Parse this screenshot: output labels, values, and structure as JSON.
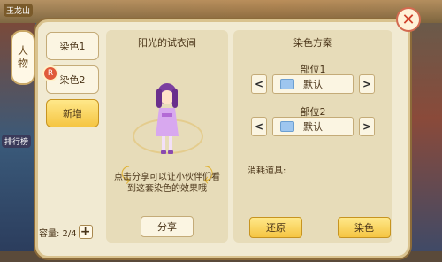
{
  "background": {
    "chips": [
      "玉龙山",
      "排行榜"
    ]
  },
  "side_tab": {
    "label": "人物"
  },
  "slots": {
    "items": [
      "染色1",
      "染色2"
    ],
    "add_label": "新增",
    "capacity_label": "容量: 2/4",
    "badge": "R"
  },
  "preview": {
    "title": "阳光的试衣间",
    "share_tip": "点击分享可以让小伙伴们看到这套染色的效果哦",
    "share_label": "分享"
  },
  "scheme": {
    "title": "染色方案",
    "parts": [
      {
        "label": "部位1",
        "value": "默认"
      },
      {
        "label": "部位2",
        "value": "默认"
      }
    ],
    "consume_label": "消耗道具:",
    "restore_label": "还原",
    "dye_label": "染色"
  },
  "colors": {
    "panel": "#f1ead2",
    "accent": "#f5c542",
    "close": "#d0402a",
    "swatch": "#9ec6ef"
  }
}
